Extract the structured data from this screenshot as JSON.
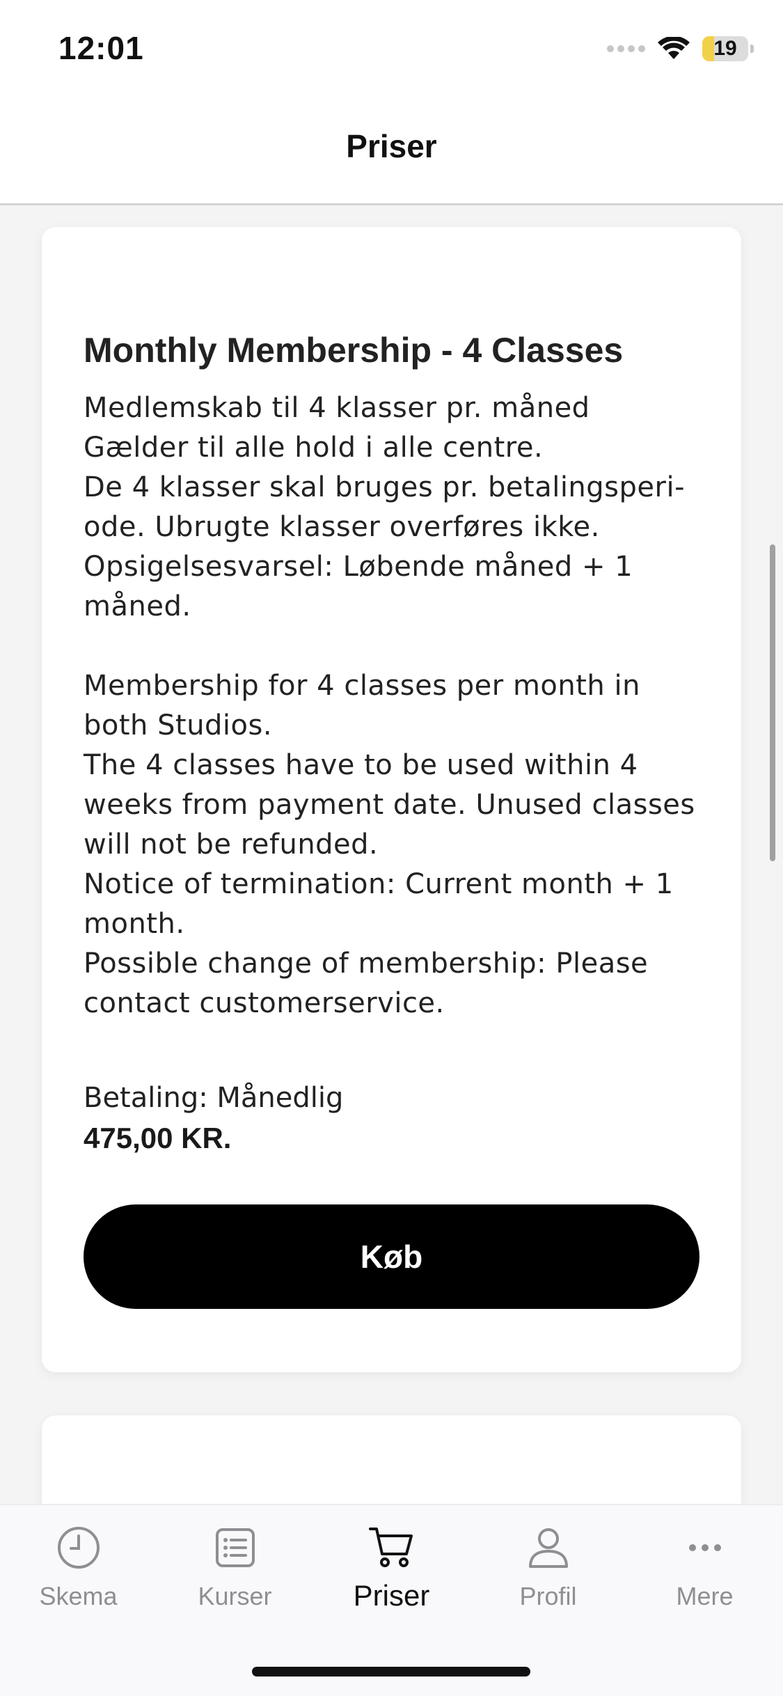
{
  "status_bar": {
    "time": "12:01",
    "battery": "19"
  },
  "header": {
    "title": "Priser"
  },
  "membership": {
    "title": "Monthly Membership - 4 Classes",
    "description": "Medlemskab til 4 klasser pr. måned\nGælder til alle hold i alle centre.\nDe 4 klasser skal bruges pr. betalingsperi-\node. Ubrugte klasser overføres ikke.\nOpsigelsesvarsel: Løbende måned + 1\nmåned.\n\nMembership for 4 classes per month in\nboth Studios.\nThe 4 classes have to be used within 4\nweeks from payment date. Unused classes\nwill not be refunded.\nNotice of termination: Current month + 1\nmonth.\nPossible change of membership: Please\ncontact customerservice.",
    "billing": "Betaling: Månedlig",
    "price": "475,00 KR.",
    "buy_label": "Køb"
  },
  "tabs": [
    {
      "label": "Skema",
      "icon": "clock-icon",
      "active": false
    },
    {
      "label": "Kurser",
      "icon": "list-icon",
      "active": false
    },
    {
      "label": "Priser",
      "icon": "cart-icon",
      "active": true
    },
    {
      "label": "Profil",
      "icon": "person-icon",
      "active": false
    },
    {
      "label": "Mere",
      "icon": "more-icon",
      "active": false
    }
  ],
  "colors": {
    "accent": "#000000",
    "inactive_tab": "#8e8e93",
    "battery": "#f2d14a"
  }
}
